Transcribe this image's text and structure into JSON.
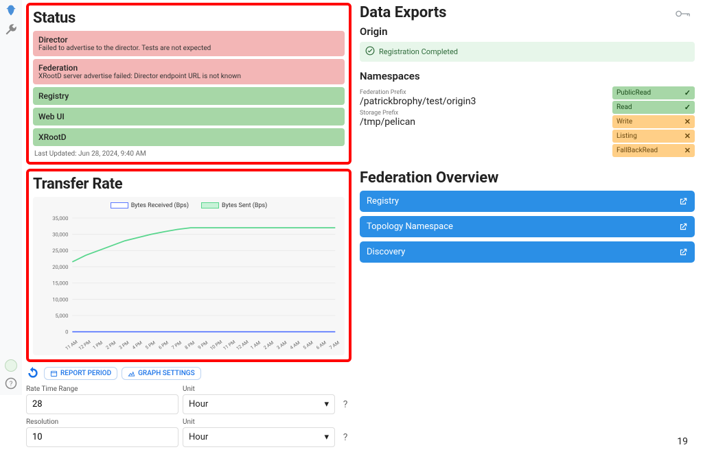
{
  "page_number": "19",
  "status": {
    "heading": "Status",
    "last_updated": "Last Updated: Jun 28, 2024, 9:40 AM",
    "items": [
      {
        "title": "Director",
        "msg": "Failed to advertise to the director. Tests are not expected",
        "cls": "status-err"
      },
      {
        "title": "Federation",
        "msg": "XRootD server advertise failed: Director endpoint URL is not known",
        "cls": "status-err"
      },
      {
        "title": "Registry",
        "msg": "",
        "cls": "status-ok"
      },
      {
        "title": "Web UI",
        "msg": "",
        "cls": "status-ok"
      },
      {
        "title": "XRootD",
        "msg": "",
        "cls": "status-ok"
      }
    ]
  },
  "transfer": {
    "heading": "Transfer Rate",
    "report_period_btn": "REPORT PERIOD",
    "graph_settings_btn": "GRAPH SETTINGS",
    "legend_recv": "Bytes Received (Bps)",
    "legend_sent": "Bytes Sent (Bps)",
    "form": {
      "rate_label": "Rate Time Range",
      "rate_value": "28",
      "res_label": "Resolution",
      "res_value": "10",
      "unit_label": "Unit",
      "unit_value": "Hour"
    }
  },
  "chart_data": {
    "type": "line",
    "xlabel": "",
    "ylabel": "",
    "ylim": [
      0,
      35000
    ],
    "yticks": [
      0,
      5000,
      10000,
      15000,
      20000,
      25000,
      30000,
      35000
    ],
    "categories": [
      "11 AM",
      "12 PM",
      "1 PM",
      "2 PM",
      "3 PM",
      "4 PM",
      "5 PM",
      "6 PM",
      "7 PM",
      "8 PM",
      "9 PM",
      "10 PM",
      "11 PM",
      "12 AM",
      "1 AM",
      "2 AM",
      "3 AM",
      "4 AM",
      "5 AM",
      "6 AM",
      "7 AM"
    ],
    "series": [
      {
        "name": "Bytes Received (Bps)",
        "color": "#5a78ff",
        "values": [
          0,
          0,
          0,
          0,
          0,
          0,
          0,
          0,
          0,
          0,
          0,
          0,
          0,
          0,
          0,
          0,
          0,
          0,
          0,
          0,
          0
        ]
      },
      {
        "name": "Bytes Sent (Bps)",
        "color": "#58d68d",
        "values": [
          21500,
          23500,
          25000,
          26500,
          28000,
          29000,
          30000,
          30800,
          31500,
          32000,
          32000,
          32000,
          32000,
          32000,
          32000,
          32000,
          32000,
          32000,
          32000,
          32000,
          32000
        ]
      }
    ]
  },
  "exports": {
    "heading": "Data Exports",
    "origin_heading": "Origin",
    "reg_banner": "Registration Completed",
    "ns_heading": "Namespaces",
    "fed_prefix_label": "Federation Prefix",
    "fed_prefix": "/patrickbrophy/test/origin3",
    "storage_prefix_label": "Storage Prefix",
    "storage_prefix": "/tmp/pelican",
    "badges": [
      {
        "label": "PublicRead",
        "cls": "green",
        "mark": "✓"
      },
      {
        "label": "Read",
        "cls": "green",
        "mark": "✓"
      },
      {
        "label": "Write",
        "cls": "orange",
        "mark": "✕"
      },
      {
        "label": "Listing",
        "cls": "orange",
        "mark": "✕"
      },
      {
        "label": "FallBackRead",
        "cls": "orange",
        "mark": "✕"
      }
    ]
  },
  "federation": {
    "heading": "Federation Overview",
    "items": [
      {
        "label": "Registry"
      },
      {
        "label": "Topology Namespace"
      },
      {
        "label": "Discovery"
      }
    ]
  }
}
